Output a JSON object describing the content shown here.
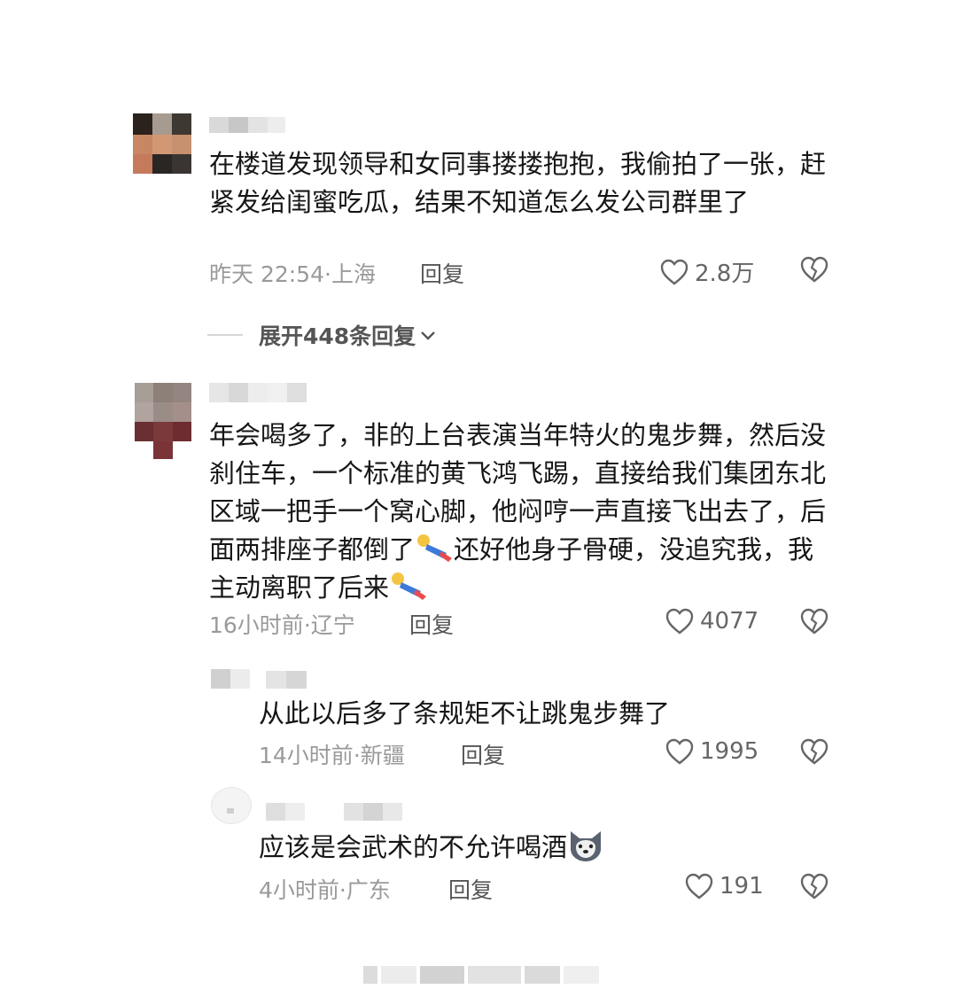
{
  "comments": [
    {
      "text": "在楼道发现领导和女同事搂搂抱抱，我偷拍了一张，赶紧发给闺蜜吃瓜，结果不知道怎么发公司群里了",
      "time": "昨天 22:54",
      "location": "上海",
      "reply_label": "回复",
      "likes": "2.8万"
    },
    {
      "text": "年会喝多了，非的上台表演当年特火的鬼步舞，然后没刹住车，一个标准的黄飞鸿飞踢，直接给我们集团东北区域一把手一个窝心脚，他闷哼一声直接飞出去了，后面两排座子都倒了",
      "text_b": "还好他身子骨硬，没追究我，我主动离职了后来",
      "time": "16小时前",
      "location": "辽宁",
      "reply_label": "回复",
      "likes": "4077"
    }
  ],
  "expand": {
    "label": "展开448条回复"
  },
  "replies": [
    {
      "text": "从此以后多了条规矩不让跳鬼步舞了",
      "time": "14小时前",
      "location": "新疆",
      "reply_label": "回复",
      "likes": "1995"
    },
    {
      "text": "应该是会武术的不允许喝酒",
      "time": "4小时前",
      "location": "广东",
      "reply_label": "回复",
      "likes": "191"
    }
  ],
  "icons": {
    "like": "heart-outline-icon",
    "dislike": "broken-heart-icon",
    "expand": "chevron-down-icon",
    "emoji_flying": "flying-person-emoji",
    "emoji_dog": "husky-dog-emoji"
  },
  "colors": {
    "text": "#161616",
    "meta": "#9a9a9a",
    "reply": "#555555"
  }
}
